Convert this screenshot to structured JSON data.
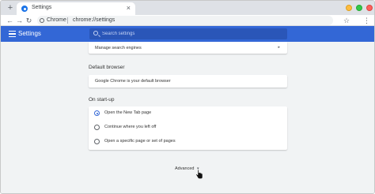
{
  "browser": {
    "tab": {
      "title": "Settings",
      "favicon": "settings-gear-icon"
    },
    "new_tab_symbol": "+",
    "tab_close_symbol": "×",
    "nav": {
      "back": "←",
      "forward": "→",
      "reload": "↻"
    },
    "omnibox": {
      "scheme_label": "Chrome",
      "url": "chrome://settings"
    },
    "star_symbol": "☆",
    "menu_symbol": "⋮",
    "window_controls": [
      "#fdbc40",
      "#34c84a",
      "#fc615d"
    ]
  },
  "header": {
    "title": "Settings",
    "search_placeholder": "Search settings",
    "color": "#3367d6"
  },
  "search_engine": {
    "manage_label": "Manage search engines",
    "arrow": "▸"
  },
  "default_browser": {
    "section_title": "Default browser",
    "status": "Google Chrome is your default browser"
  },
  "startup": {
    "section_title": "On start-up",
    "options": [
      {
        "label": "Open the New Tab page",
        "selected": true
      },
      {
        "label": "Continue where you left off",
        "selected": false
      },
      {
        "label": "Open a specific page or set of pages",
        "selected": false
      }
    ]
  },
  "advanced": {
    "label": "Advanced",
    "arrow": "▾"
  }
}
